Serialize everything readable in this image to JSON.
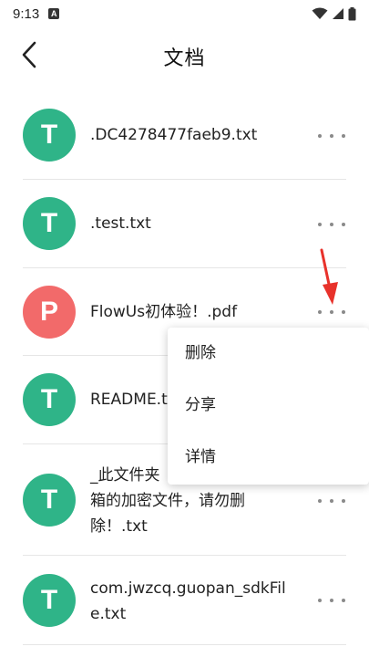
{
  "status": {
    "time": "9:13",
    "app_icon_letter": "A"
  },
  "header": {
    "title": "文档"
  },
  "files": [
    {
      "name": ".DC4278477faeb9.txt",
      "letter": "T",
      "color": "#2fb488"
    },
    {
      "name": ".test.txt",
      "letter": "T",
      "color": "#2fb488"
    },
    {
      "name": "FlowUs初体验！.pdf",
      "letter": "P",
      "color": "#f26a6a"
    },
    {
      "name": "README.t",
      "letter": "T",
      "color": "#2fb488"
    },
    {
      "name": "_此文件夹",
      "name_line2": "箱的加密文件，请勿删",
      "name_line3": "除！.txt",
      "letter": "T",
      "color": "#2fb488"
    },
    {
      "name": "com.jwzcq.guopan_sdkFil",
      "name_line2": "e.txt",
      "letter": "T",
      "color": "#2fb488"
    }
  ],
  "context_menu": {
    "items": [
      "删除",
      "分享",
      "详情"
    ]
  },
  "colors": {
    "annotation_arrow": "#e8322b",
    "more_dots": "#8a8a8a"
  },
  "icons": {
    "back": "chevron-left-icon",
    "more": "more-horizontal-icon",
    "wifi": "wifi-icon",
    "signal": "cell-signal-icon",
    "battery": "battery-icon"
  }
}
